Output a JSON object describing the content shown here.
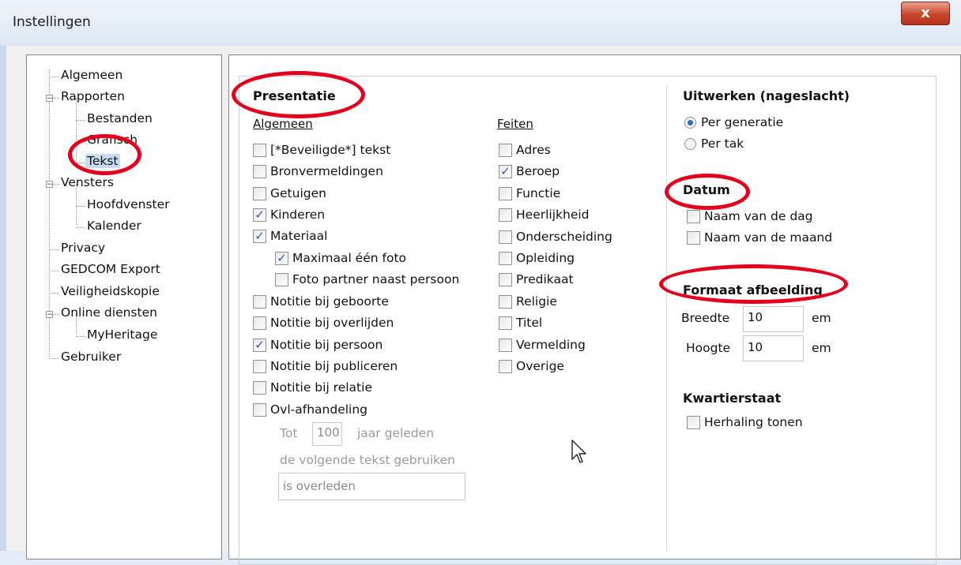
{
  "window": {
    "title": "Instellingen",
    "close_glyph": "x"
  },
  "tree": {
    "items": [
      {
        "label": "Algemeen",
        "name": "tree-item-algemeen"
      },
      {
        "label": "Rapporten",
        "name": "tree-item-rapporten"
      },
      {
        "label": "Bestanden",
        "name": "tree-item-bestanden"
      },
      {
        "label": "Grafisch",
        "name": "tree-item-grafisch"
      },
      {
        "label": "Tekst",
        "name": "tree-item-tekst",
        "selected": true
      },
      {
        "label": "Vensters",
        "name": "tree-item-vensters"
      },
      {
        "label": "Hoofdvenster",
        "name": "tree-item-hoofdvenster"
      },
      {
        "label": "Kalender",
        "name": "tree-item-kalender"
      },
      {
        "label": "Privacy",
        "name": "tree-item-privacy"
      },
      {
        "label": "GEDCOM Export",
        "name": "tree-item-gedcom-export"
      },
      {
        "label": "Veiligheidskopie",
        "name": "tree-item-veiligheidskopie"
      },
      {
        "label": "Online diensten",
        "name": "tree-item-online-diensten"
      },
      {
        "label": "MyHeritage",
        "name": "tree-item-myheritage"
      },
      {
        "label": "Gebruiker",
        "name": "tree-item-gebruiker"
      }
    ]
  },
  "presentatie": {
    "title": "Presentatie",
    "algemeen": {
      "header": "Algemeen",
      "items": [
        {
          "label": "[*Beveiligde*] tekst",
          "checked": false
        },
        {
          "label": "Bronvermeldingen",
          "checked": false
        },
        {
          "label": "Getuigen",
          "checked": false
        },
        {
          "label": "Kinderen",
          "checked": true
        },
        {
          "label": "Materiaal",
          "checked": true
        },
        {
          "label": "Maximaal één foto",
          "checked": true
        },
        {
          "label": "Foto partner naast persoon",
          "checked": false
        },
        {
          "label": "Notitie bij geboorte",
          "checked": false
        },
        {
          "label": "Notitie bij overlijden",
          "checked": false
        },
        {
          "label": "Notitie bij persoon",
          "checked": true
        },
        {
          "label": "Notitie bij publiceren",
          "checked": false
        },
        {
          "label": "Notitie bij relatie",
          "checked": false
        },
        {
          "label": "Ovl-afhandeling",
          "checked": false
        }
      ],
      "tot_label": "Tot",
      "tot_value": "100",
      "jaar_label": "jaar geleden",
      "tekst_label": "de volgende tekst gebruiken",
      "tekst_value": "is overleden"
    },
    "feiten": {
      "header": "Feiten",
      "items": [
        {
          "label": "Adres",
          "checked": false
        },
        {
          "label": "Beroep",
          "checked": true
        },
        {
          "label": "Functie",
          "checked": false
        },
        {
          "label": "Heerlijkheid",
          "checked": false
        },
        {
          "label": "Onderscheiding",
          "checked": false
        },
        {
          "label": "Opleiding",
          "checked": false
        },
        {
          "label": "Predikaat",
          "checked": false
        },
        {
          "label": "Religie",
          "checked": false
        },
        {
          "label": "Titel",
          "checked": false
        },
        {
          "label": "Vermelding",
          "checked": false
        },
        {
          "label": "Overige",
          "checked": false
        }
      ]
    }
  },
  "uitwerken": {
    "title": "Uitwerken (nageslacht)",
    "options": [
      {
        "label": "Per generatie",
        "selected": true
      },
      {
        "label": "Per tak",
        "selected": false
      }
    ]
  },
  "datum": {
    "title": "Datum",
    "items": [
      {
        "label": "Naam van de dag",
        "checked": false
      },
      {
        "label": "Naam van de maand",
        "checked": false
      }
    ]
  },
  "formaat": {
    "title": "Formaat afbeelding",
    "breedte_label": "Breedte",
    "breedte_value": "10",
    "hoogte_label": "Hoogte",
    "hoogte_value": "10",
    "unit": "em"
  },
  "kwartierstaat": {
    "title": "Kwartierstaat",
    "items": [
      {
        "label": "Herhaling tonen",
        "checked": false
      }
    ]
  },
  "colors": {
    "annotation": "#e4001b",
    "selection": "#c7dcef",
    "check": "#2b5fa8"
  },
  "check_glyph": "✓"
}
